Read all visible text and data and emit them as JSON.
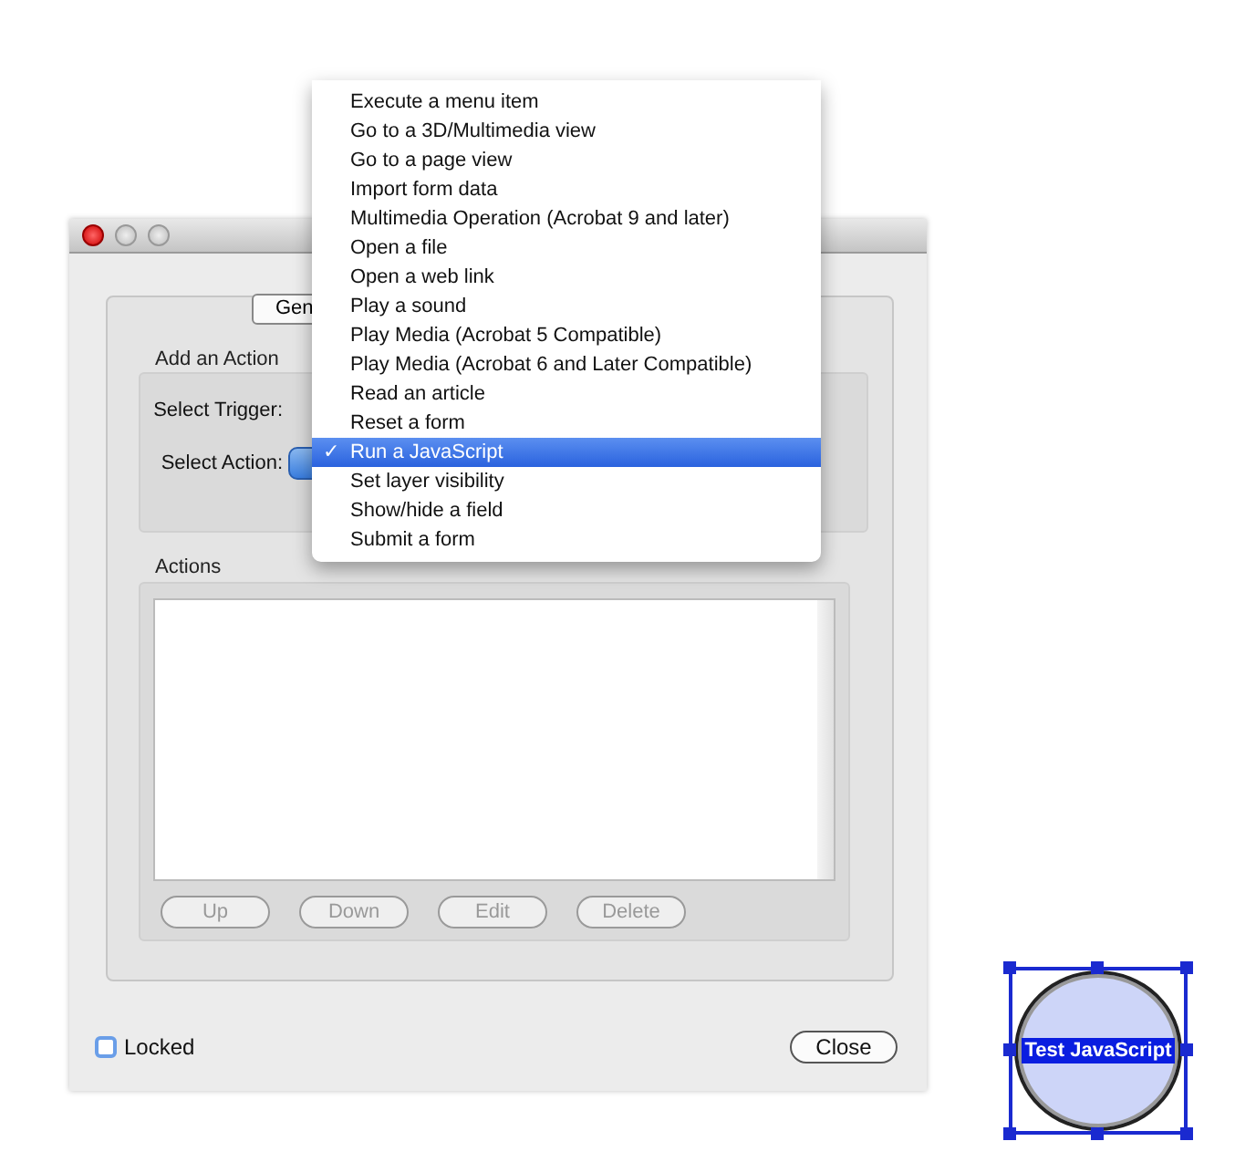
{
  "window": {
    "tab": "Gen",
    "add_action": {
      "title": "Add an Action",
      "trigger_label": "Select Trigger:",
      "action_label": "Select Action:"
    },
    "actions": {
      "title": "Actions",
      "buttons": [
        {
          "label": "Up",
          "disabled": true
        },
        {
          "label": "Down",
          "disabled": true
        },
        {
          "label": "Edit",
          "disabled": true
        },
        {
          "label": "Delete",
          "disabled": true
        }
      ]
    },
    "locked": {
      "label": "Locked",
      "checked": false
    },
    "close_button": "Close"
  },
  "menu": {
    "check_mark": "✓",
    "items": [
      {
        "label": "Execute a menu item",
        "selected": false
      },
      {
        "label": "Go to a 3D/Multimedia view",
        "selected": false
      },
      {
        "label": "Go to a page view",
        "selected": false
      },
      {
        "label": "Import form data",
        "selected": false
      },
      {
        "label": "Multimedia Operation (Acrobat 9 and later)",
        "selected": false
      },
      {
        "label": "Open a file",
        "selected": false
      },
      {
        "label": "Open a web link",
        "selected": false
      },
      {
        "label": "Play a sound",
        "selected": false
      },
      {
        "label": "Play Media (Acrobat 5 Compatible)",
        "selected": false
      },
      {
        "label": "Play Media (Acrobat 6 and Later Compatible)",
        "selected": false
      },
      {
        "label": "Read an article",
        "selected": false
      },
      {
        "label": "Reset a form",
        "selected": false
      },
      {
        "label": "Run a JavaScript",
        "selected": true
      },
      {
        "label": "Set layer visibility",
        "selected": false
      },
      {
        "label": "Show/hide a field",
        "selected": false
      },
      {
        "label": "Submit a form",
        "selected": false
      }
    ]
  },
  "form_button": {
    "label": "Test JavaScript",
    "selected": true
  }
}
